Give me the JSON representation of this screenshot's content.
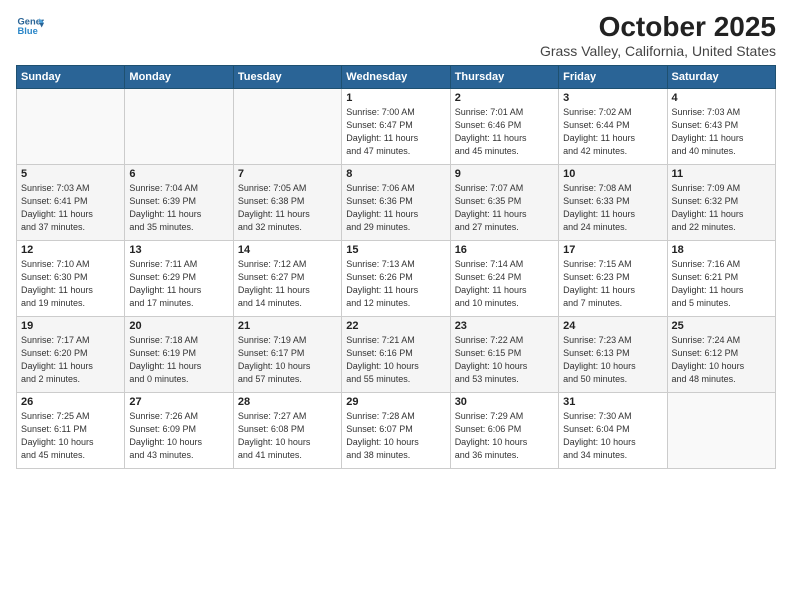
{
  "header": {
    "logo_line1": "General",
    "logo_line2": "Blue",
    "month": "October 2025",
    "location": "Grass Valley, California, United States"
  },
  "weekdays": [
    "Sunday",
    "Monday",
    "Tuesday",
    "Wednesday",
    "Thursday",
    "Friday",
    "Saturday"
  ],
  "weeks": [
    [
      {
        "day": "",
        "info": ""
      },
      {
        "day": "",
        "info": ""
      },
      {
        "day": "",
        "info": ""
      },
      {
        "day": "1",
        "info": "Sunrise: 7:00 AM\nSunset: 6:47 PM\nDaylight: 11 hours\nand 47 minutes."
      },
      {
        "day": "2",
        "info": "Sunrise: 7:01 AM\nSunset: 6:46 PM\nDaylight: 11 hours\nand 45 minutes."
      },
      {
        "day": "3",
        "info": "Sunrise: 7:02 AM\nSunset: 6:44 PM\nDaylight: 11 hours\nand 42 minutes."
      },
      {
        "day": "4",
        "info": "Sunrise: 7:03 AM\nSunset: 6:43 PM\nDaylight: 11 hours\nand 40 minutes."
      }
    ],
    [
      {
        "day": "5",
        "info": "Sunrise: 7:03 AM\nSunset: 6:41 PM\nDaylight: 11 hours\nand 37 minutes."
      },
      {
        "day": "6",
        "info": "Sunrise: 7:04 AM\nSunset: 6:39 PM\nDaylight: 11 hours\nand 35 minutes."
      },
      {
        "day": "7",
        "info": "Sunrise: 7:05 AM\nSunset: 6:38 PM\nDaylight: 11 hours\nand 32 minutes."
      },
      {
        "day": "8",
        "info": "Sunrise: 7:06 AM\nSunset: 6:36 PM\nDaylight: 11 hours\nand 29 minutes."
      },
      {
        "day": "9",
        "info": "Sunrise: 7:07 AM\nSunset: 6:35 PM\nDaylight: 11 hours\nand 27 minutes."
      },
      {
        "day": "10",
        "info": "Sunrise: 7:08 AM\nSunset: 6:33 PM\nDaylight: 11 hours\nand 24 minutes."
      },
      {
        "day": "11",
        "info": "Sunrise: 7:09 AM\nSunset: 6:32 PM\nDaylight: 11 hours\nand 22 minutes."
      }
    ],
    [
      {
        "day": "12",
        "info": "Sunrise: 7:10 AM\nSunset: 6:30 PM\nDaylight: 11 hours\nand 19 minutes."
      },
      {
        "day": "13",
        "info": "Sunrise: 7:11 AM\nSunset: 6:29 PM\nDaylight: 11 hours\nand 17 minutes."
      },
      {
        "day": "14",
        "info": "Sunrise: 7:12 AM\nSunset: 6:27 PM\nDaylight: 11 hours\nand 14 minutes."
      },
      {
        "day": "15",
        "info": "Sunrise: 7:13 AM\nSunset: 6:26 PM\nDaylight: 11 hours\nand 12 minutes."
      },
      {
        "day": "16",
        "info": "Sunrise: 7:14 AM\nSunset: 6:24 PM\nDaylight: 11 hours\nand 10 minutes."
      },
      {
        "day": "17",
        "info": "Sunrise: 7:15 AM\nSunset: 6:23 PM\nDaylight: 11 hours\nand 7 minutes."
      },
      {
        "day": "18",
        "info": "Sunrise: 7:16 AM\nSunset: 6:21 PM\nDaylight: 11 hours\nand 5 minutes."
      }
    ],
    [
      {
        "day": "19",
        "info": "Sunrise: 7:17 AM\nSunset: 6:20 PM\nDaylight: 11 hours\nand 2 minutes."
      },
      {
        "day": "20",
        "info": "Sunrise: 7:18 AM\nSunset: 6:19 PM\nDaylight: 11 hours\nand 0 minutes."
      },
      {
        "day": "21",
        "info": "Sunrise: 7:19 AM\nSunset: 6:17 PM\nDaylight: 10 hours\nand 57 minutes."
      },
      {
        "day": "22",
        "info": "Sunrise: 7:21 AM\nSunset: 6:16 PM\nDaylight: 10 hours\nand 55 minutes."
      },
      {
        "day": "23",
        "info": "Sunrise: 7:22 AM\nSunset: 6:15 PM\nDaylight: 10 hours\nand 53 minutes."
      },
      {
        "day": "24",
        "info": "Sunrise: 7:23 AM\nSunset: 6:13 PM\nDaylight: 10 hours\nand 50 minutes."
      },
      {
        "day": "25",
        "info": "Sunrise: 7:24 AM\nSunset: 6:12 PM\nDaylight: 10 hours\nand 48 minutes."
      }
    ],
    [
      {
        "day": "26",
        "info": "Sunrise: 7:25 AM\nSunset: 6:11 PM\nDaylight: 10 hours\nand 45 minutes."
      },
      {
        "day": "27",
        "info": "Sunrise: 7:26 AM\nSunset: 6:09 PM\nDaylight: 10 hours\nand 43 minutes."
      },
      {
        "day": "28",
        "info": "Sunrise: 7:27 AM\nSunset: 6:08 PM\nDaylight: 10 hours\nand 41 minutes."
      },
      {
        "day": "29",
        "info": "Sunrise: 7:28 AM\nSunset: 6:07 PM\nDaylight: 10 hours\nand 38 minutes."
      },
      {
        "day": "30",
        "info": "Sunrise: 7:29 AM\nSunset: 6:06 PM\nDaylight: 10 hours\nand 36 minutes."
      },
      {
        "day": "31",
        "info": "Sunrise: 7:30 AM\nSunset: 6:04 PM\nDaylight: 10 hours\nand 34 minutes."
      },
      {
        "day": "",
        "info": ""
      }
    ]
  ]
}
